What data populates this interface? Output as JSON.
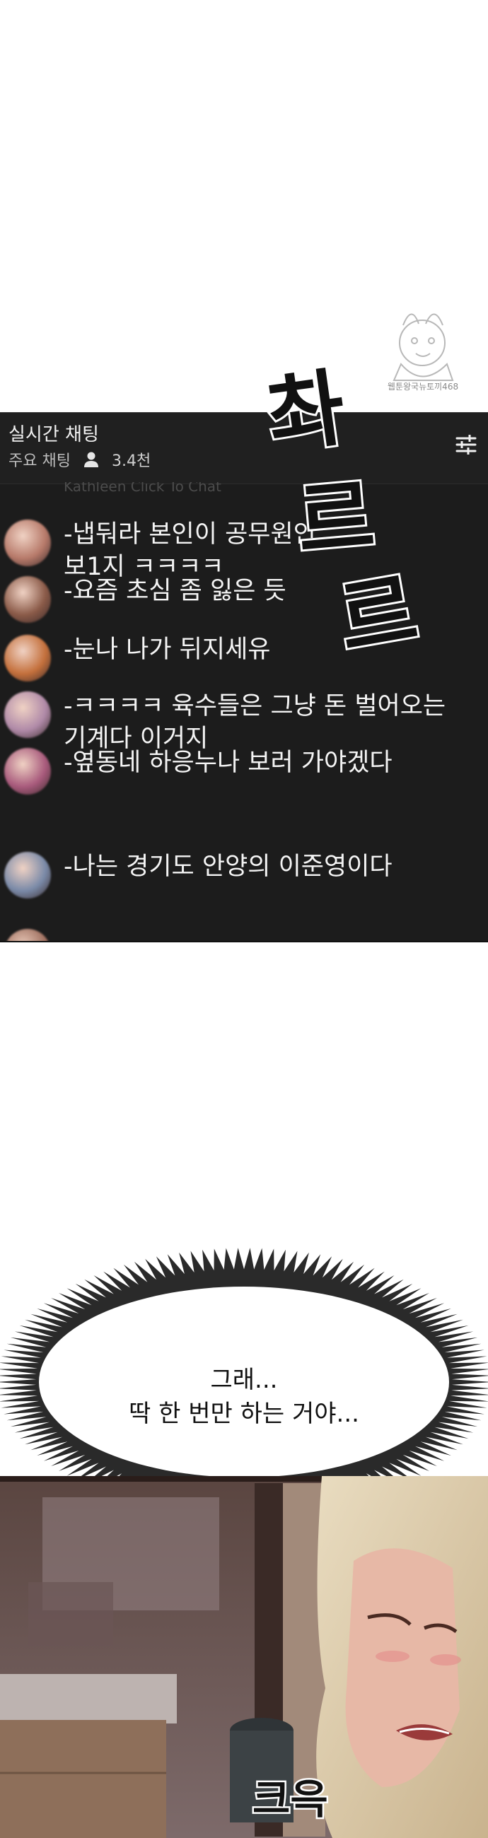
{
  "watermark": {
    "text": "웹툰왕국뉴토끼468"
  },
  "chat": {
    "title": "실시간 채팅",
    "subtitle": "주요 채팅",
    "viewer_count": "3.4천",
    "ghost_row": "Kathleen Click To Chat",
    "messages": [
      {
        "lines": [
          "-냅둬라 본인이 공무원인",
          "보1지 ㅋㅋㅋㅋ"
        ],
        "avatar_color": "#b77a6a"
      },
      {
        "lines": [
          "-요즘 초심 좀 잃은 듯"
        ],
        "avatar_color": "#8a5a48"
      },
      {
        "lines": [
          "-눈나 나가 뒤지세유"
        ],
        "avatar_color": "#c4703c"
      },
      {
        "lines": [
          "-ㅋㅋㅋㅋ 육수들은 그냥 돈 벌어오는",
          "기계다 이거지"
        ],
        "avatar_color": "#b08aa8"
      },
      {
        "lines": [
          "-옆동네 하응누나 보러 가야겠다"
        ],
        "avatar_color": "#a85a7c"
      },
      {
        "lines": [
          "-나는 경기도 안양의 이준영이다"
        ],
        "avatar_color": "#7a8aa8"
      }
    ]
  },
  "sfx": {
    "text": "촤르르"
  },
  "bubble": {
    "lines": [
      "그래...",
      "딱 한 번만 하는 거야..."
    ]
  },
  "sfx_bottom": {
    "text": "크윽"
  },
  "colors": {
    "chat_bg": "#1c1c1c",
    "chat_text": "#f4f4f4",
    "page_bg": "#ffffff"
  }
}
